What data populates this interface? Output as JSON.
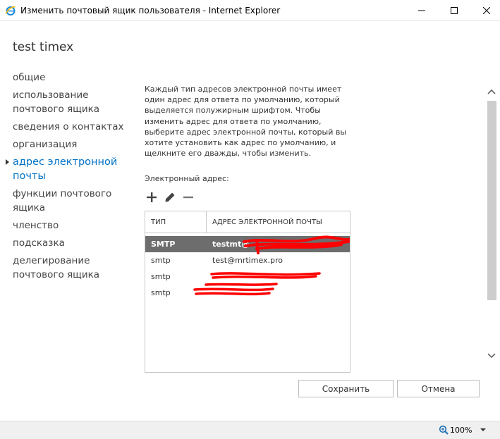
{
  "window": {
    "title": "Изменить почтовый ящик пользователя - Internet Explorer"
  },
  "page": {
    "title": "test timex"
  },
  "nav": {
    "items": [
      {
        "label": "общие"
      },
      {
        "label": "использование почтового ящика"
      },
      {
        "label": "сведения о контактах"
      },
      {
        "label": "организация"
      },
      {
        "label": "адрес электронной почты",
        "active": true
      },
      {
        "label": "функции почтового ящика"
      },
      {
        "label": "членство"
      },
      {
        "label": "подсказка"
      },
      {
        "label": "делегирование почтового ящика"
      }
    ]
  },
  "content": {
    "description": "Каждый тип адресов электронной почты имеет один адрес для ответа по умолчанию, который выделяется полужирным шрифтом. Чтобы изменить адрес для ответа по умолчанию, выберите адрес электронной почты, который вы хотите установить как адрес по умолчанию, и щелкните его дважды, чтобы изменить.",
    "email_label": "Электронный адрес:",
    "toolbar": {
      "add_icon": "plus-icon",
      "edit_icon": "pencil-icon",
      "remove_icon": "minus-icon"
    },
    "table": {
      "headers": {
        "type": "ТИП",
        "address": "АДРЕС ЭЛЕКТРОННОЙ ПОЧТЫ"
      },
      "rows": [
        {
          "type": "SMTP",
          "address": "testmt@",
          "selected": true
        },
        {
          "type": "smtp",
          "address": "test@mrtimex.pro"
        },
        {
          "type": "smtp",
          "address": ""
        },
        {
          "type": "smtp",
          "address": ""
        }
      ]
    }
  },
  "buttons": {
    "save": "Сохранить",
    "cancel": "Отмена"
  },
  "statusbar": {
    "zoom": "100%"
  },
  "colors": {
    "accent": "#0072c6",
    "selected_row": "#6d6d6d",
    "redaction": "#ff0000"
  }
}
